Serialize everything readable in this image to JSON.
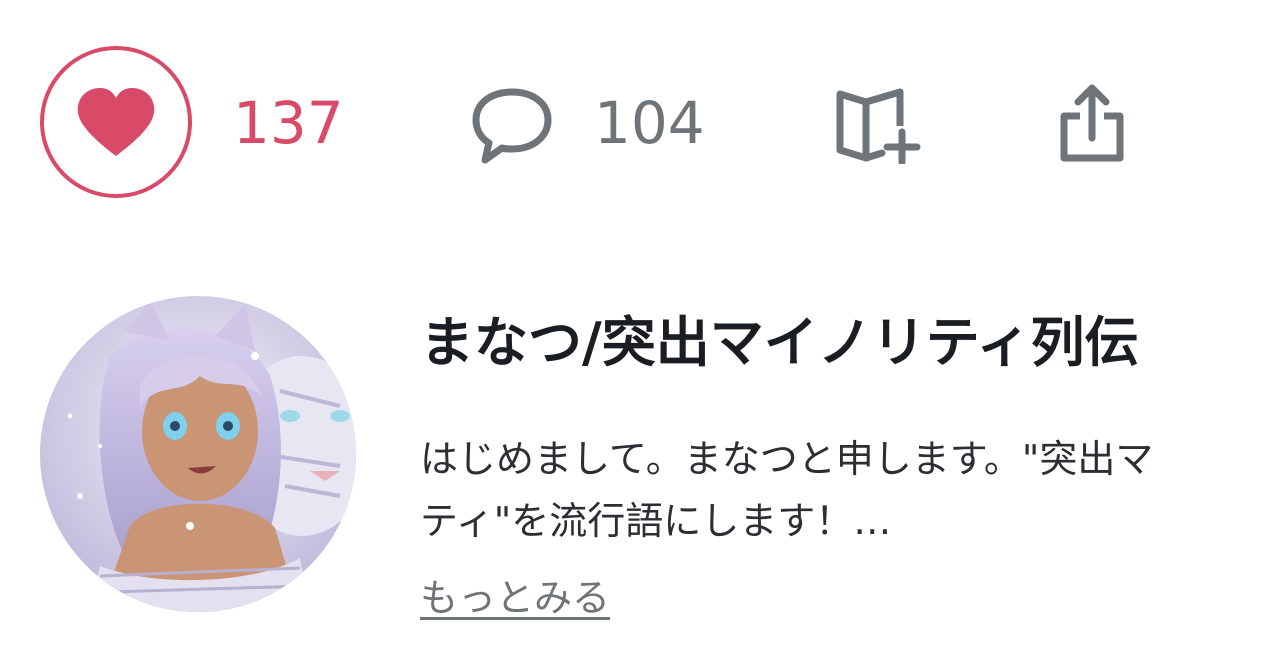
{
  "actions": {
    "like_count": "137",
    "comment_count": "104",
    "like_icon": "heart-icon",
    "comment_icon": "speech-bubble-icon",
    "magazine_icon": "book-plus-icon",
    "share_icon": "share-upload-icon"
  },
  "creator": {
    "name": "まなつ/突出マイノリティ列伝",
    "bio_line1": "はじめまして。まなつと申します。\"突出マ",
    "bio_line2": "ティ\"を流行語にします！…",
    "more_label": "もっとみる",
    "avatar_icon": "anime-girl-with-white-tiger-avatar"
  },
  "colors": {
    "accent": "#d84a68",
    "muted": "#6f7479",
    "text": "#1a1d21"
  }
}
